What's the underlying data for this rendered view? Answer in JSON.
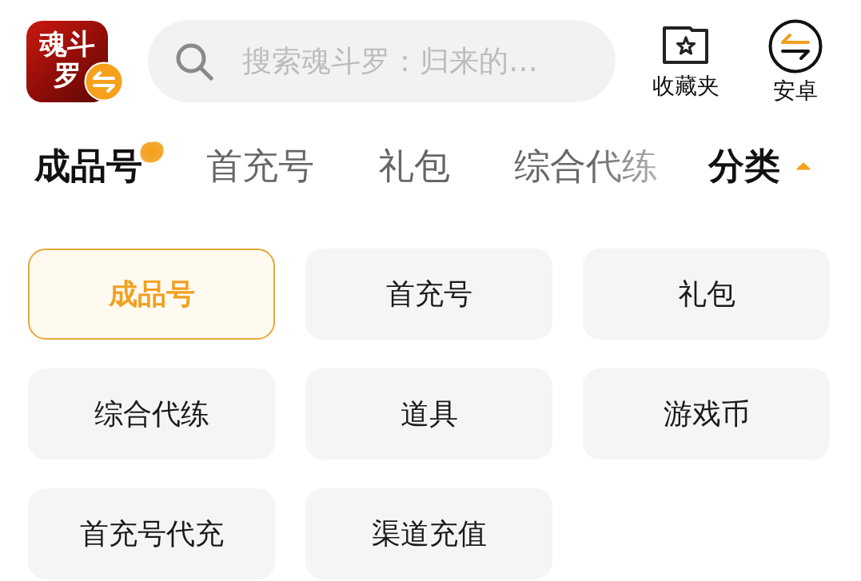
{
  "app": {
    "logo_text": "魂斗罗"
  },
  "search": {
    "placeholder": "搜索魂斗罗：归来的…"
  },
  "actions": [
    {
      "label": "收藏夹",
      "kind": "favorites"
    },
    {
      "label": "安卓",
      "kind": "platform"
    }
  ],
  "tabs": [
    {
      "label": "成品号",
      "selected": true
    },
    {
      "label": "首充号",
      "selected": false
    },
    {
      "label": "礼包",
      "selected": false
    },
    {
      "label": "综合代练",
      "selected": false
    }
  ],
  "category_menu": {
    "label": "分类",
    "expanded": true
  },
  "categories": [
    {
      "label": "成品号",
      "selected": true
    },
    {
      "label": "首充号",
      "selected": false
    },
    {
      "label": "礼包",
      "selected": false
    },
    {
      "label": "综合代练",
      "selected": false
    },
    {
      "label": "道具",
      "selected": false
    },
    {
      "label": "游戏币",
      "selected": false
    },
    {
      "label": "首充号代充",
      "selected": false
    },
    {
      "label": "渠道充值",
      "selected": false
    }
  ]
}
